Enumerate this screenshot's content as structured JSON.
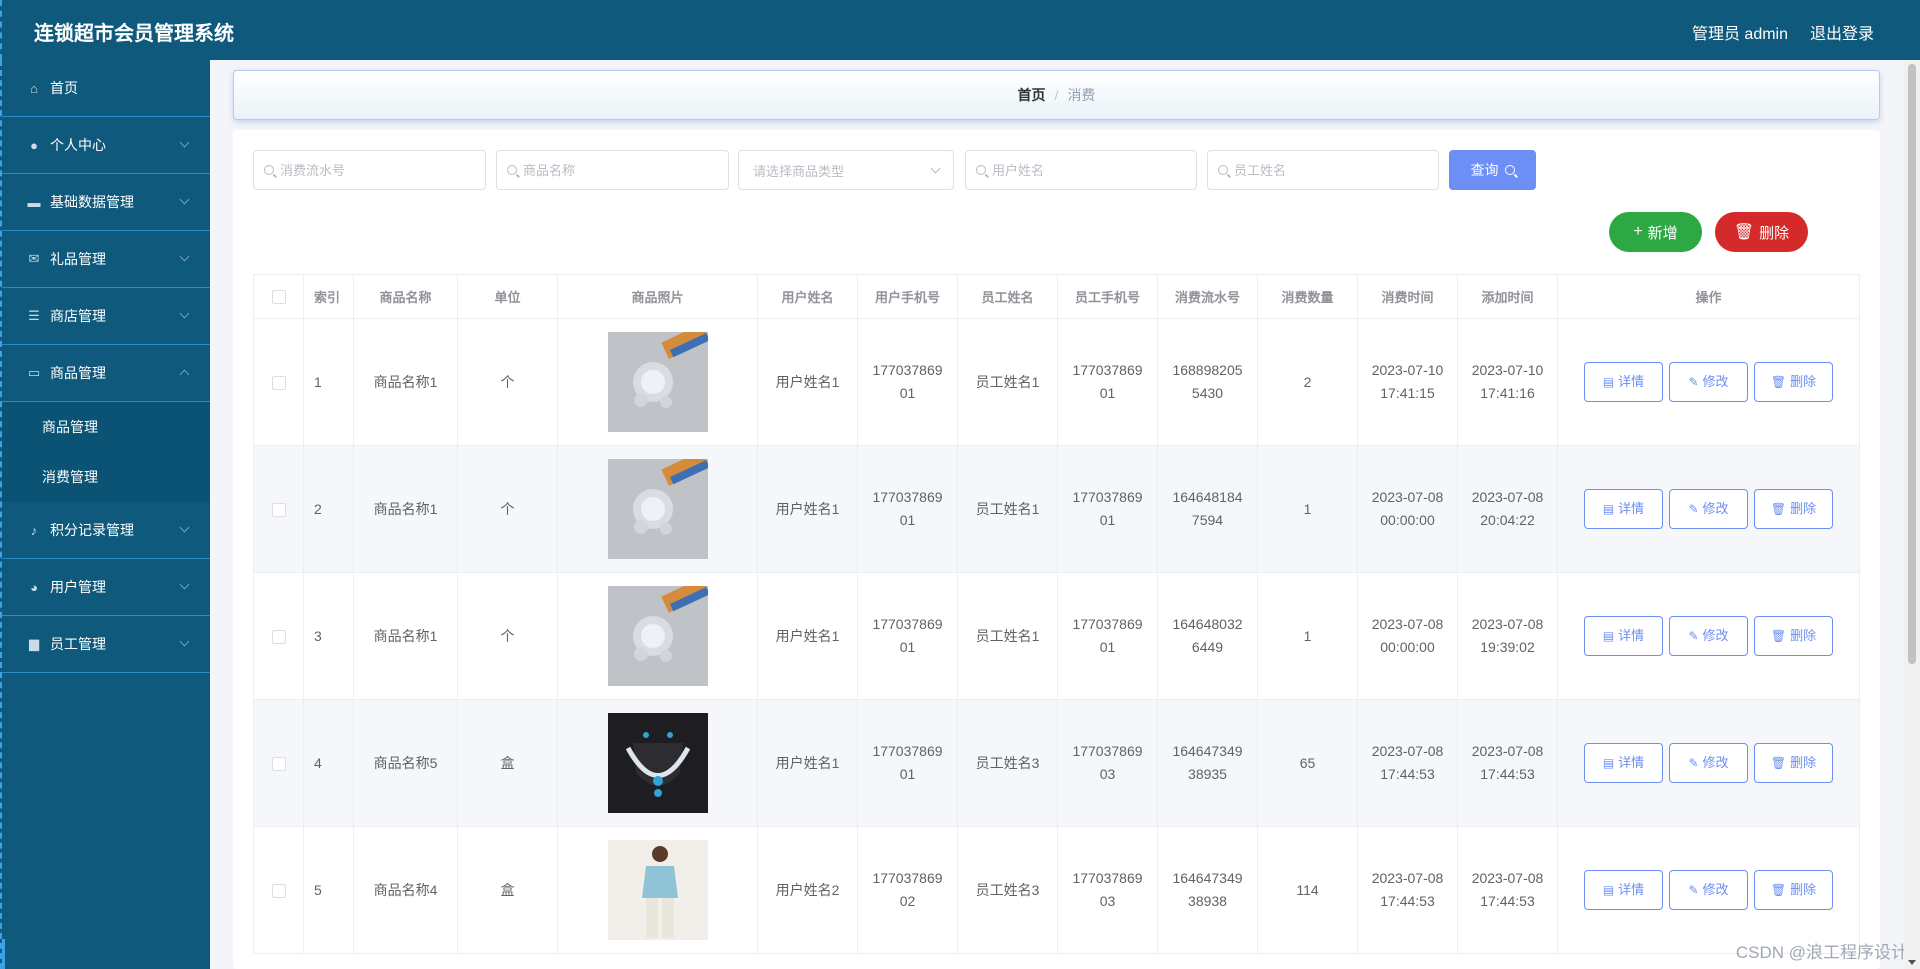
{
  "header": {
    "title": "连锁超市会员管理系统",
    "admin_label": "管理员 admin",
    "logout_label": "退出登录"
  },
  "sidebar": {
    "items": [
      {
        "label": "首页",
        "icon": "home-icon"
      },
      {
        "label": "个人中心",
        "icon": "user-icon"
      },
      {
        "label": "基础数据管理",
        "icon": "ticket-icon"
      },
      {
        "label": "礼品管理",
        "icon": "mail-icon"
      },
      {
        "label": "商店管理",
        "icon": "list-icon"
      },
      {
        "label": "商品管理",
        "icon": "chat-icon"
      },
      {
        "label": "积分记录管理",
        "icon": "microphone-icon"
      },
      {
        "label": "用户管理",
        "icon": "palette-icon"
      },
      {
        "label": "员工管理",
        "icon": "book-icon"
      }
    ],
    "sub_items": [
      "商品管理",
      "消费管理"
    ]
  },
  "breadcrumb": {
    "home": "首页",
    "separator": "/",
    "current": "消费"
  },
  "search": {
    "serial_placeholder": "消费流水号",
    "goods_name_placeholder": "商品名称",
    "goods_type_placeholder": "请选择商品类型",
    "user_name_placeholder": "用户姓名",
    "staff_name_placeholder": "员工姓名",
    "query_label": "查询"
  },
  "actions": {
    "add_label": "新增",
    "delete_label": "删除"
  },
  "table": {
    "headers": [
      "索引",
      "商品名称",
      "单位",
      "商品照片",
      "用户姓名",
      "用户手机号",
      "员工姓名",
      "员工手机号",
      "消费流水号",
      "消费数量",
      "消费时间",
      "添加时间",
      "操作"
    ],
    "row_actions": {
      "detail": "详情",
      "edit": "修改",
      "delete": "删除"
    },
    "rows": [
      {
        "index": "1",
        "name": "商品名称1",
        "unit": "个",
        "photo": "brooch",
        "user": "用户姓名1",
        "user_phone": [
          "177037869",
          "01"
        ],
        "staff": "员工姓名1",
        "staff_phone": [
          "177037869",
          "01"
        ],
        "serial": [
          "168898205",
          "5430"
        ],
        "qty": "2",
        "consume_time": [
          "2023-07-10",
          "17:41:15"
        ],
        "add_time": [
          "2023-07-10",
          "17:41:16"
        ]
      },
      {
        "index": "2",
        "name": "商品名称1",
        "unit": "个",
        "photo": "brooch",
        "user": "用户姓名1",
        "user_phone": [
          "177037869",
          "01"
        ],
        "staff": "员工姓名1",
        "staff_phone": [
          "177037869",
          "01"
        ],
        "serial": [
          "164648184",
          "7594"
        ],
        "qty": "1",
        "consume_time": [
          "2023-07-08",
          "00:00:00"
        ],
        "add_time": [
          "2023-07-08",
          "20:04:22"
        ]
      },
      {
        "index": "3",
        "name": "商品名称1",
        "unit": "个",
        "photo": "brooch",
        "user": "用户姓名1",
        "user_phone": [
          "177037869",
          "01"
        ],
        "staff": "员工姓名1",
        "staff_phone": [
          "177037869",
          "01"
        ],
        "serial": [
          "164648032",
          "6449"
        ],
        "qty": "1",
        "consume_time": [
          "2023-07-08",
          "00:00:00"
        ],
        "add_time": [
          "2023-07-08",
          "19:39:02"
        ]
      },
      {
        "index": "4",
        "name": "商品名称5",
        "unit": "盒",
        "photo": "necklace",
        "user": "用户姓名1",
        "user_phone": [
          "177037869",
          "01"
        ],
        "staff": "员工姓名3",
        "staff_phone": [
          "177037869",
          "03"
        ],
        "serial": [
          "164647349",
          "38935"
        ],
        "qty": "65",
        "consume_time": [
          "2023-07-08",
          "17:44:53"
        ],
        "add_time": [
          "2023-07-08",
          "17:44:53"
        ]
      },
      {
        "index": "5",
        "name": "商品名称4",
        "unit": "盒",
        "photo": "clothing",
        "user": "用户姓名2",
        "user_phone": [
          "177037869",
          "02"
        ],
        "staff": "员工姓名3",
        "staff_phone": [
          "177037869",
          "03"
        ],
        "serial": [
          "164647349",
          "38938"
        ],
        "qty": "114",
        "consume_time": [
          "2023-07-08",
          "17:44:53"
        ],
        "add_time": [
          "2023-07-08",
          "17:44:53"
        ]
      }
    ]
  },
  "watermark": "CSDN @浪工程序设计",
  "colors": {
    "nav": "#0f5a7c",
    "primary": "#6c8ef5",
    "add": "#2ea843",
    "danger": "#d42a2a"
  }
}
